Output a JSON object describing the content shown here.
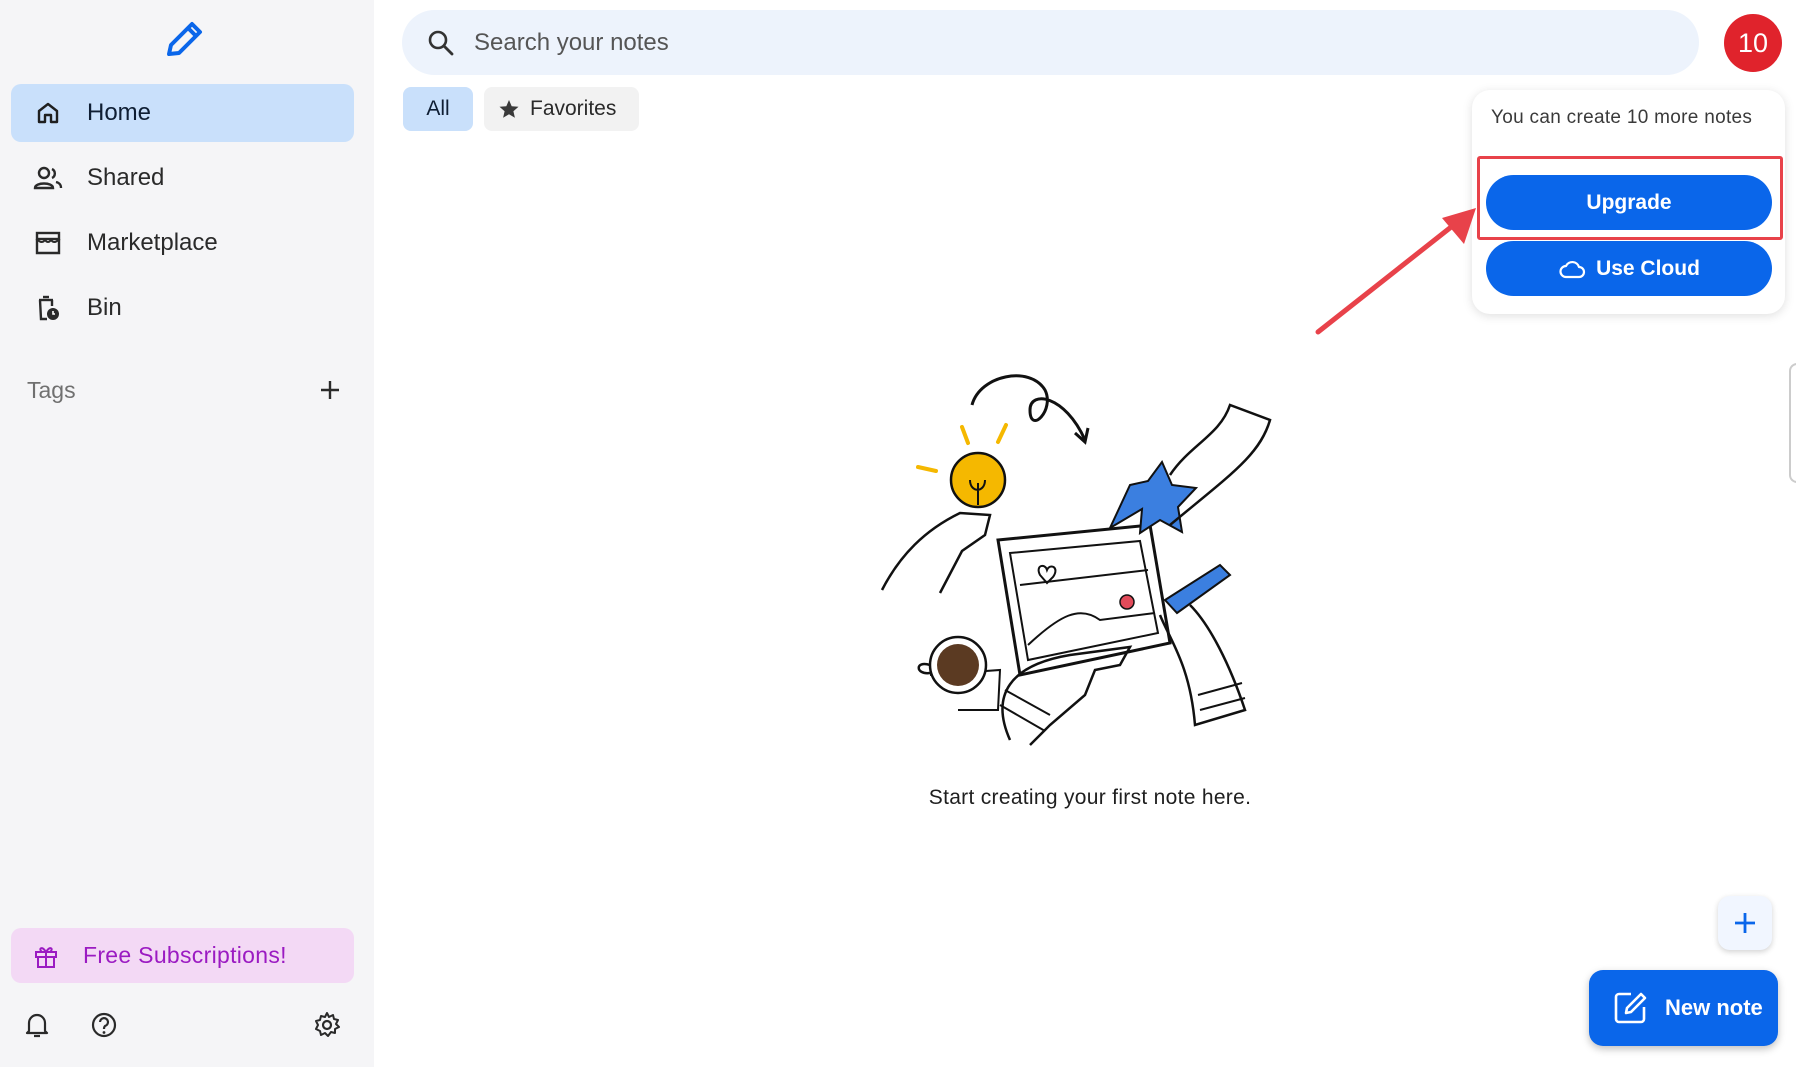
{
  "sidebar": {
    "items": [
      {
        "label": "Home",
        "icon": "home-icon",
        "active": true
      },
      {
        "label": "Shared",
        "icon": "people-icon",
        "active": false
      },
      {
        "label": "Marketplace",
        "icon": "store-icon",
        "active": false
      },
      {
        "label": "Bin",
        "icon": "bin-icon",
        "active": false
      }
    ],
    "tags_label": "Tags",
    "promo_label": "Free Subscriptions!"
  },
  "search": {
    "placeholder": "Search your notes"
  },
  "avatar": {
    "count": "10"
  },
  "filters": {
    "all_label": "All",
    "favorites_label": "Favorites"
  },
  "popup": {
    "message": "You can create 10 more notes",
    "upgrade_label": "Upgrade",
    "cloud_label": "Use Cloud"
  },
  "empty_state": {
    "text": "Start creating your first note here."
  },
  "fab": {
    "new_note_label": "New note"
  },
  "colors": {
    "accent": "#0a66ea",
    "sidebar_bg": "#f5f5f7",
    "active_bg": "#c9e0fb",
    "promo_bg": "#f3d9f5",
    "promo_text": "#9b1bc2",
    "avatar_bg": "#e0232c",
    "annotation_red": "#e8424a"
  }
}
